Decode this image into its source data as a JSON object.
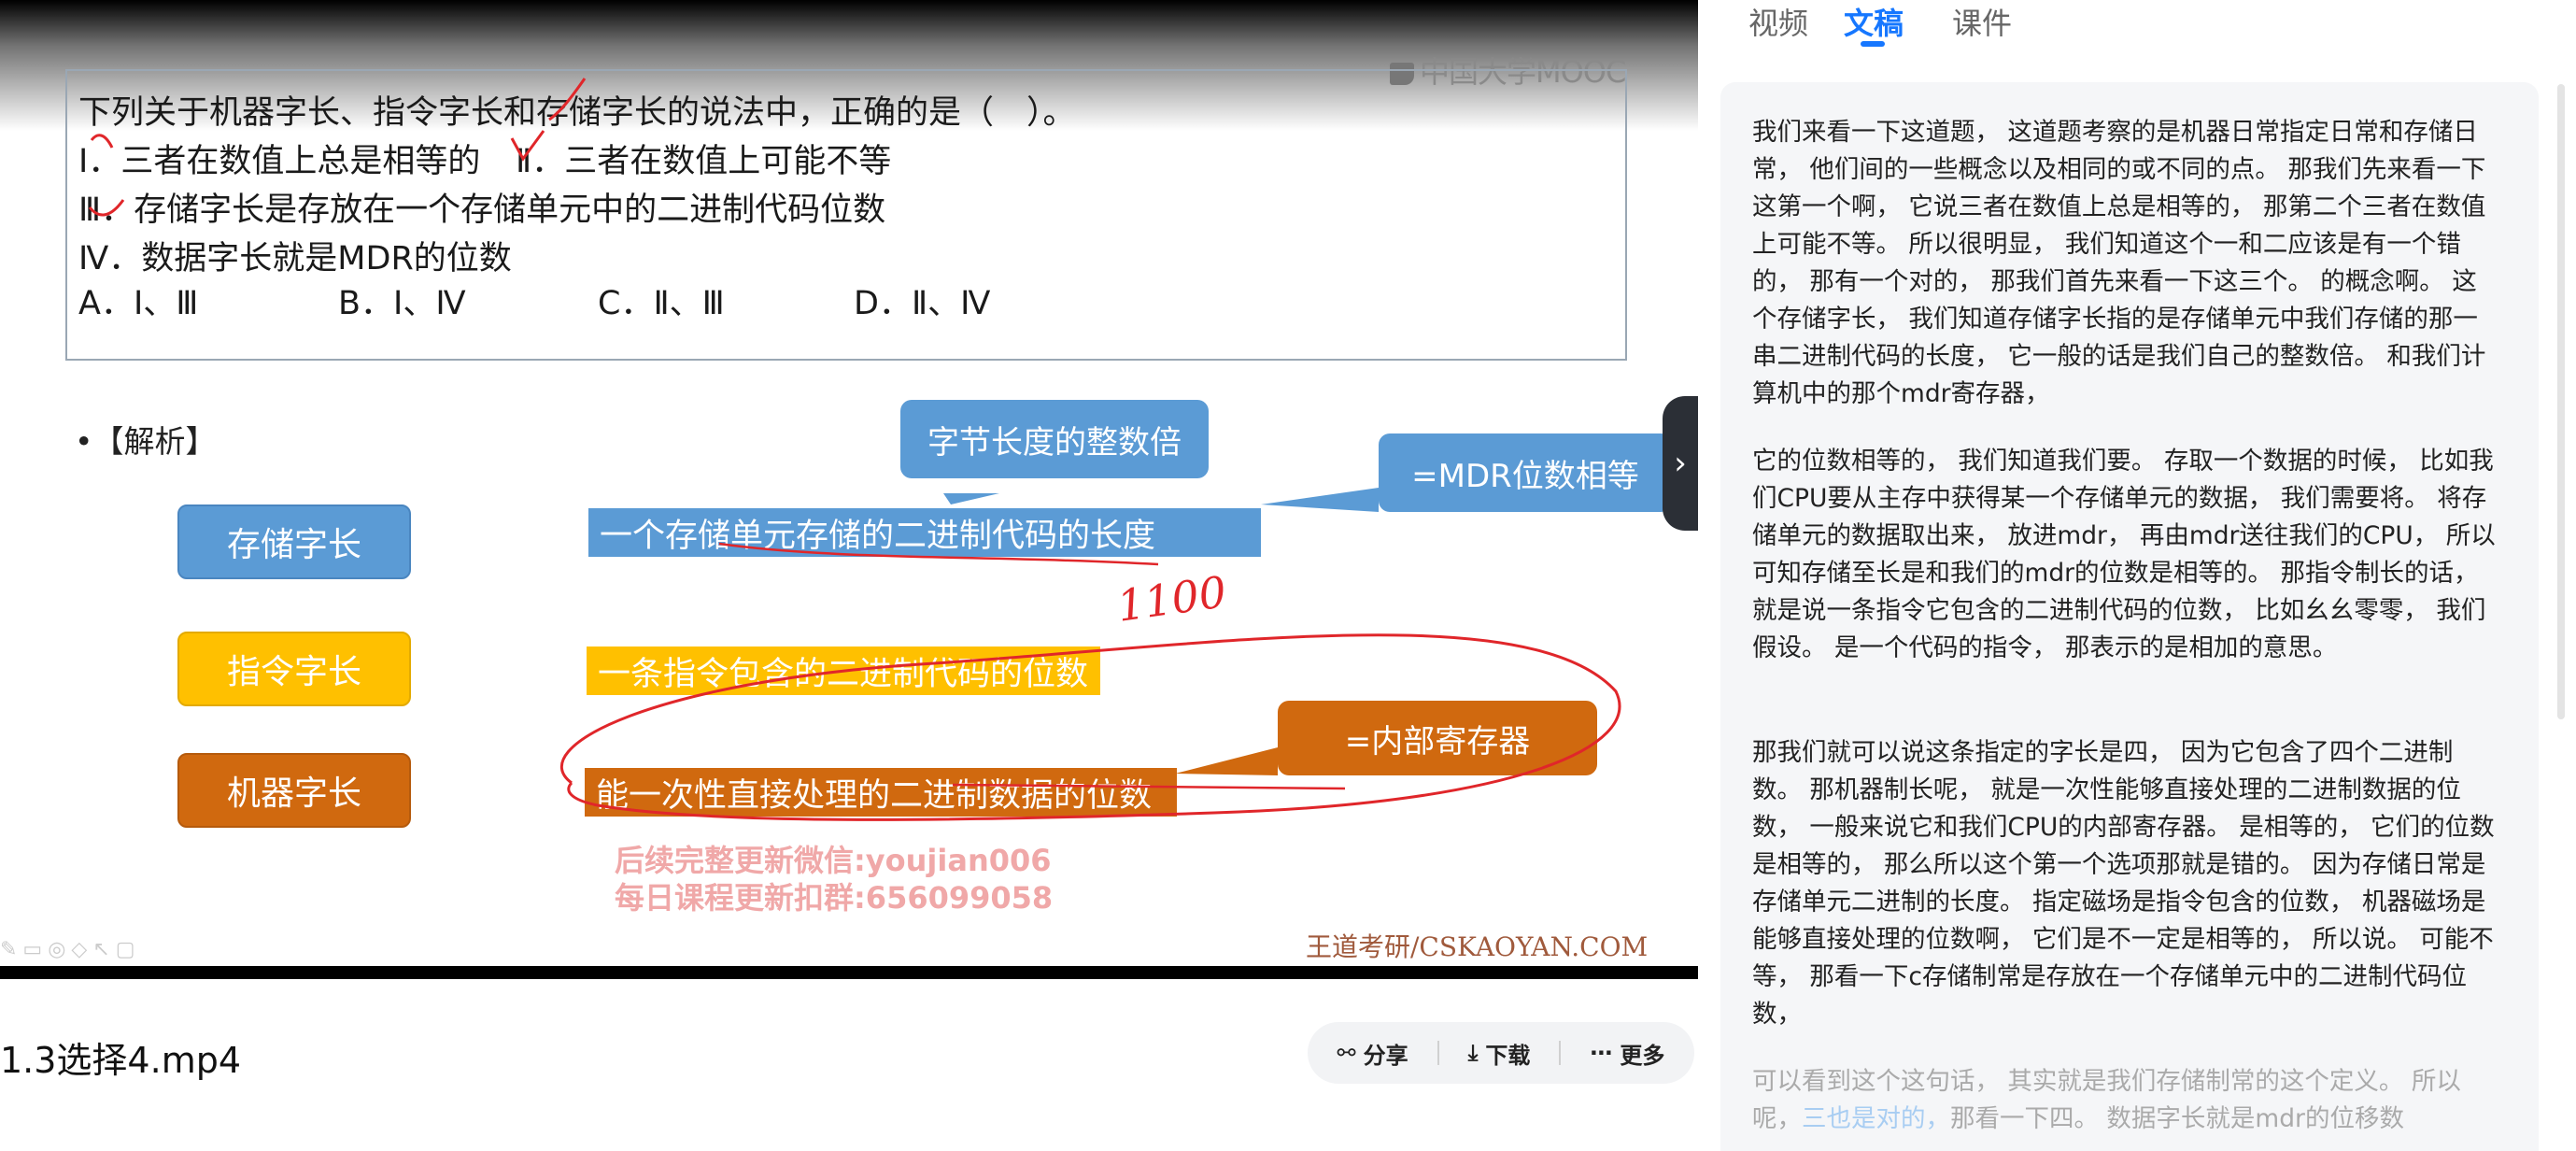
{
  "video": {
    "logo": "中国大学MOOC",
    "question": {
      "stem": "下列关于机器字长、指令字长和存储字长的说法中，正确的是（　）。",
      "line1": "Ⅰ．三者在数值上总是相等的",
      "line1b": "Ⅱ．三者在数值上可能不等",
      "line2": "Ⅲ．存储字长是存放在一个存储单元中的二进制代码位数",
      "line3": "Ⅳ．数据字长就是MDR的位数",
      "options": [
        "A．Ⅰ、Ⅲ",
        "B．Ⅰ、Ⅳ",
        "C．Ⅱ、Ⅲ",
        "D．Ⅱ、Ⅳ"
      ]
    },
    "analysis_title": "•【解析】",
    "rows": [
      {
        "label": "存储字长",
        "desc": "一个存储单元存储的二进制代码的长度"
      },
      {
        "label": "指令字长",
        "desc": "一条指令包含的二进制代码的位数"
      },
      {
        "label": "机器字长",
        "desc": "能一次性直接处理的二进制数据的位数"
      }
    ],
    "callouts": {
      "byte_multiple": "字节长度的整数倍",
      "mdr": "=MDR位数相等",
      "register": "=内部寄存器"
    },
    "handwriting": "1100",
    "watermark_line1": "后续完整更新微信:youjian006",
    "watermark_line2": "每日课程更新扣群:656099058",
    "source": "王道考研/CSKAOYAN.COM",
    "colors": {
      "blue": "#5b9bd5",
      "yellow": "#ffc000",
      "orange": "#d0690f",
      "annotation_red": "#e0262a"
    }
  },
  "file_title": "1.3选择4.mp4",
  "actions": {
    "share": "分享",
    "download": "下载",
    "more": "更多"
  },
  "tabs": {
    "video": "视频",
    "transcript": "文稿",
    "courseware": "课件"
  },
  "transcript": {
    "p1": "我们来看一下这道题， 这道题考察的是机器日常指定日常和存储日常， 他们间的一些概念以及相同的或不同的点。 那我们先来看一下这第一个啊， 它说三者在数值上总是相等的， 那第二个三者在数值上可能不等。 所以很明显， 我们知道这个一和二应该是有一个错的， 那有一个对的， 那我们首先来看一下这三个。 的概念啊。 这个存储字长， 我们知道存储字长指的是存储单元中我们存储的那一串二进制代码的长度， 它一般的话是我们自己的整数倍。 和我们计算机中的那个mdr寄存器，",
    "p2": "它的位数相等的， 我们知道我们要。 存取一个数据的时候， 比如我们CPU要从主存中获得某一个存储单元的数据， 我们需要将。 将存储单元的数据取出来， 放进mdr， 再由mdr送往我们的CPU， 所以可知存储至长是和我们的mdr的位数是相等的。 那指令制长的话， 就是说一条指令它包含的二进制代码的位数， 比如幺幺零零， 我们假设。 是一个代码的指令， 那表示的是相加的意思。",
    "p3": "那我们就可以说这条指定的字长是四， 因为它包含了四个二进制数。 那机器制长呢， 就是一次性能够直接处理的二进制数据的位数， 一般来说它和我们CPU的内部寄存器。 是相等的， 它们的位数是相等的， 那么所以这个第一个选项那就是错的。 因为存储日常是存储单元二进制的长度。 指定磁场是指令包含的位数， 机器磁场是能够直接处理的位数啊， 它们是不一定是相等的， 所以说。 可能不等， 那看一下c存储制常是存放在一个存储单元中的二进制代码位数，",
    "p4_start": "可以看到这个这句话， 其实就是我们存储制常的这个定义。 所以呢，",
    "p4_highlight": "三也是对的，",
    "p4_end": "那看一下四。 数据字长就是mdr的位移数"
  }
}
